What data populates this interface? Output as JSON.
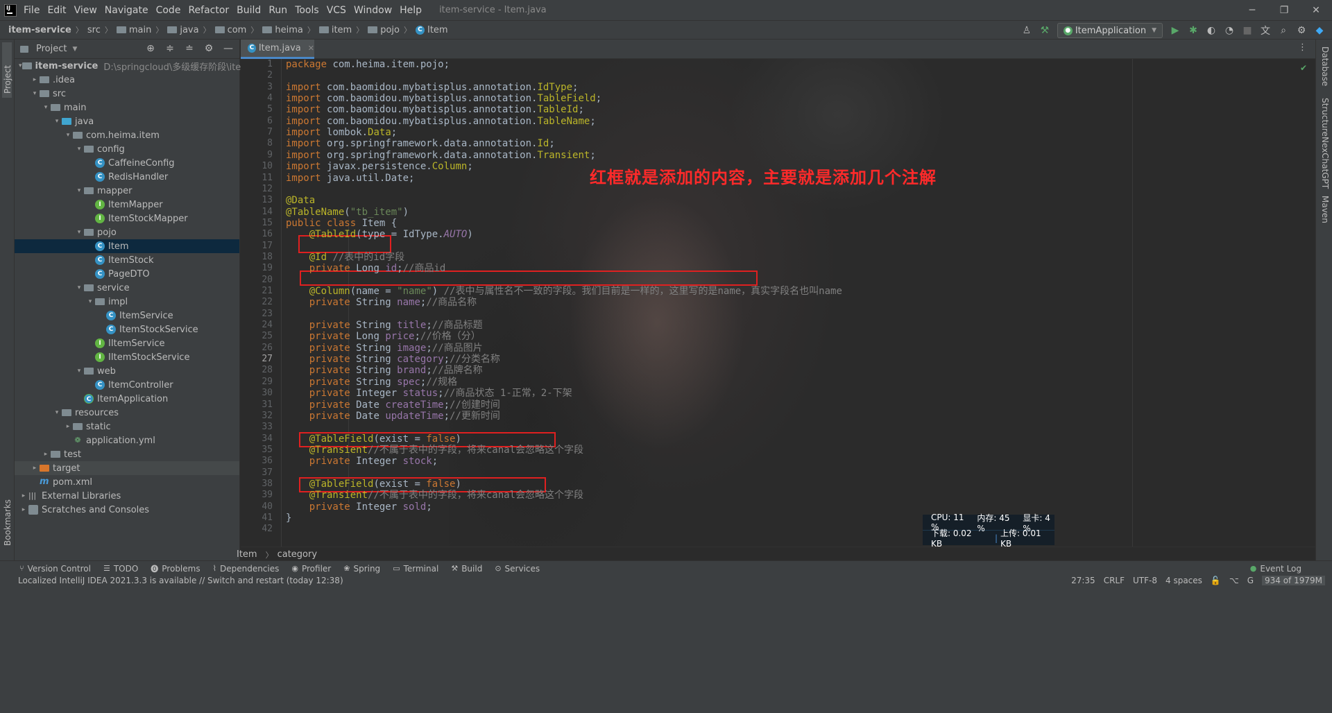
{
  "window": {
    "title": "item-service - Item.java",
    "menu": [
      "File",
      "Edit",
      "View",
      "Navigate",
      "Code",
      "Refactor",
      "Build",
      "Run",
      "Tools",
      "VCS",
      "Window",
      "Help"
    ],
    "minimize": "─",
    "restore": "❐",
    "close": "✕"
  },
  "navbar": {
    "crumbs": [
      "item-service",
      "src",
      "main",
      "java",
      "com",
      "heima",
      "item",
      "pojo",
      "Item"
    ],
    "run_config": "ItemApplication"
  },
  "left_strip": {
    "project_label": "Project",
    "bookmarks_label": "Bookmarks"
  },
  "right_strip": {
    "labels": [
      "Database",
      "Structure",
      "NexChatGPT",
      "Maven"
    ]
  },
  "project_panel": {
    "title": "Project",
    "root_name": "item-service",
    "root_path": "D:\\springcloud\\多级缓存阶段\\item-",
    "tree": [
      {
        "label": "item-service",
        "depth": 0,
        "icon": "folder",
        "chev": "down"
      },
      {
        "label": ".idea",
        "depth": 1,
        "icon": "folder",
        "chev": "right"
      },
      {
        "label": "src",
        "depth": 1,
        "icon": "folder",
        "chev": "down"
      },
      {
        "label": "main",
        "depth": 2,
        "icon": "folder",
        "chev": "down"
      },
      {
        "label": "java",
        "depth": 3,
        "icon": "folder-blue",
        "chev": "down"
      },
      {
        "label": "com.heima.item",
        "depth": 4,
        "icon": "folder",
        "chev": "down"
      },
      {
        "label": "config",
        "depth": 5,
        "icon": "folder",
        "chev": "down"
      },
      {
        "label": "CaffeineConfig",
        "depth": 6,
        "icon": "class",
        "chev": ""
      },
      {
        "label": "RedisHandler",
        "depth": 6,
        "icon": "class",
        "chev": ""
      },
      {
        "label": "mapper",
        "depth": 5,
        "icon": "folder",
        "chev": "down"
      },
      {
        "label": "ItemMapper",
        "depth": 6,
        "icon": "iface",
        "chev": ""
      },
      {
        "label": "ItemStockMapper",
        "depth": 6,
        "icon": "iface",
        "chev": ""
      },
      {
        "label": "pojo",
        "depth": 5,
        "icon": "folder",
        "chev": "down"
      },
      {
        "label": "Item",
        "depth": 6,
        "icon": "class",
        "chev": "",
        "selected": true
      },
      {
        "label": "ItemStock",
        "depth": 6,
        "icon": "class",
        "chev": ""
      },
      {
        "label": "PageDTO",
        "depth": 6,
        "icon": "class",
        "chev": ""
      },
      {
        "label": "service",
        "depth": 5,
        "icon": "folder",
        "chev": "down"
      },
      {
        "label": "impl",
        "depth": 6,
        "icon": "folder",
        "chev": "down"
      },
      {
        "label": "ItemService",
        "depth": 7,
        "icon": "class",
        "chev": ""
      },
      {
        "label": "ItemStockService",
        "depth": 7,
        "icon": "class",
        "chev": ""
      },
      {
        "label": "IItemService",
        "depth": 6,
        "icon": "iface",
        "chev": ""
      },
      {
        "label": "IItemStockService",
        "depth": 6,
        "icon": "iface",
        "chev": ""
      },
      {
        "label": "web",
        "depth": 5,
        "icon": "folder",
        "chev": "down"
      },
      {
        "label": "ItemController",
        "depth": 6,
        "icon": "class",
        "chev": ""
      },
      {
        "label": "ItemApplication",
        "depth": 5,
        "icon": "app",
        "chev": ""
      },
      {
        "label": "resources",
        "depth": 3,
        "icon": "folder",
        "chev": "down"
      },
      {
        "label": "static",
        "depth": 4,
        "icon": "folder",
        "chev": "right"
      },
      {
        "label": "application.yml",
        "depth": 4,
        "icon": "yml",
        "chev": ""
      },
      {
        "label": "test",
        "depth": 2,
        "icon": "folder",
        "chev": "right"
      },
      {
        "label": "target",
        "depth": 1,
        "icon": "folder-orange",
        "chev": "right",
        "hovered": true
      },
      {
        "label": "pom.xml",
        "depth": 1,
        "icon": "m",
        "chev": ""
      },
      {
        "label": "External Libraries",
        "depth": 0,
        "icon": "lib",
        "chev": "right"
      },
      {
        "label": "Scratches and Consoles",
        "depth": 0,
        "icon": "scratch",
        "chev": "right"
      }
    ]
  },
  "editor": {
    "tab_label": "Item.java",
    "current_line": 27,
    "annotation_text": "红框就是添加的内容，主要就是添加几个注解",
    "breadcrumb": [
      "Item",
      "category"
    ],
    "lines": [
      [
        [
          "kw",
          "package "
        ],
        [
          "",
          "com.heima.item.pojo;"
        ]
      ],
      [],
      [
        [
          "kw",
          "import "
        ],
        [
          "",
          "com.baomidou.mybatisplus.annotation."
        ],
        [
          "ann",
          "IdType"
        ],
        [
          "",
          "; "
        ]
      ],
      [
        [
          "kw",
          "import "
        ],
        [
          "",
          "com.baomidou.mybatisplus.annotation."
        ],
        [
          "ann",
          "TableField"
        ],
        [
          "",
          ";"
        ]
      ],
      [
        [
          "kw",
          "import "
        ],
        [
          "",
          "com.baomidou.mybatisplus.annotation."
        ],
        [
          "ann",
          "TableId"
        ],
        [
          "",
          ";"
        ]
      ],
      [
        [
          "kw",
          "import "
        ],
        [
          "",
          "com.baomidou.mybatisplus.annotation."
        ],
        [
          "ann",
          "TableName"
        ],
        [
          "",
          ";"
        ]
      ],
      [
        [
          "kw",
          "import "
        ],
        [
          "",
          "lombok."
        ],
        [
          "ann",
          "Data"
        ],
        [
          "",
          ";"
        ]
      ],
      [
        [
          "kw",
          "import "
        ],
        [
          "",
          "org.springframework.data.annotation."
        ],
        [
          "ann",
          "Id"
        ],
        [
          "",
          ";"
        ]
      ],
      [
        [
          "kw",
          "import "
        ],
        [
          "",
          "org.springframework.data.annotation."
        ],
        [
          "ann",
          "Transient"
        ],
        [
          "",
          ";"
        ]
      ],
      [
        [
          "kw",
          "import "
        ],
        [
          "",
          "javax.persistence."
        ],
        [
          "ann",
          "Column"
        ],
        [
          "",
          ";"
        ]
      ],
      [
        [
          "kw",
          "import "
        ],
        [
          "",
          "java.util.Date;"
        ]
      ],
      [],
      [
        [
          "ann",
          "@Data"
        ]
      ],
      [
        [
          "ann",
          "@TableName"
        ],
        [
          "",
          "("
        ],
        [
          "str",
          "\"tb_item\""
        ],
        [
          "",
          ")"
        ]
      ],
      [
        [
          "kw",
          "public class "
        ],
        [
          "",
          "Item {"
        ]
      ],
      [
        [
          "",
          "    "
        ],
        [
          "ann",
          "@TableId"
        ],
        [
          "",
          "(type = IdType."
        ],
        [
          "cst",
          "AUTO"
        ],
        [
          "",
          ")"
        ]
      ],
      [],
      [
        [
          "",
          "    "
        ],
        [
          "ann",
          "@Id "
        ],
        [
          "cmt",
          "//表中的id字段"
        ]
      ],
      [
        [
          "",
          "    "
        ],
        [
          "kw",
          "private "
        ],
        [
          "",
          "Long "
        ],
        [
          "fld",
          "id"
        ],
        [
          "",
          ";"
        ],
        [
          "cmt",
          "//商品id"
        ]
      ],
      [],
      [
        [
          "",
          "    "
        ],
        [
          "ann",
          "@Column"
        ],
        [
          "",
          "(name = "
        ],
        [
          "str",
          "\"name\""
        ],
        [
          "",
          ") "
        ],
        [
          "cmt",
          "//表中与属性名不一致的字段。我们目前是一样的，这里写的是name，真实字段名也叫name"
        ]
      ],
      [
        [
          "",
          "    "
        ],
        [
          "kw",
          "private "
        ],
        [
          "",
          "String "
        ],
        [
          "fld",
          "name"
        ],
        [
          "",
          ";"
        ],
        [
          "cmt",
          "//商品名称"
        ]
      ],
      [],
      [
        [
          "",
          "    "
        ],
        [
          "kw",
          "private "
        ],
        [
          "",
          "String "
        ],
        [
          "fld",
          "title"
        ],
        [
          "",
          ";"
        ],
        [
          "cmt",
          "//商品标题"
        ]
      ],
      [
        [
          "",
          "    "
        ],
        [
          "kw",
          "private "
        ],
        [
          "",
          "Long "
        ],
        [
          "fld",
          "price"
        ],
        [
          "",
          ";"
        ],
        [
          "cmt",
          "//价格（分）"
        ]
      ],
      [
        [
          "",
          "    "
        ],
        [
          "kw",
          "private "
        ],
        [
          "",
          "String "
        ],
        [
          "fld",
          "image"
        ],
        [
          "",
          ";"
        ],
        [
          "cmt",
          "//商品图片"
        ]
      ],
      [
        [
          "",
          "    "
        ],
        [
          "kw",
          "private "
        ],
        [
          "",
          "String "
        ],
        [
          "fld",
          "category"
        ],
        [
          "",
          ";"
        ],
        [
          "cmt",
          "//分类名称"
        ]
      ],
      [
        [
          "",
          "    "
        ],
        [
          "kw",
          "private "
        ],
        [
          "",
          "String "
        ],
        [
          "fld",
          "brand"
        ],
        [
          "",
          ";"
        ],
        [
          "cmt",
          "//品牌名称"
        ]
      ],
      [
        [
          "",
          "    "
        ],
        [
          "kw",
          "private "
        ],
        [
          "",
          "String "
        ],
        [
          "fld",
          "spec"
        ],
        [
          "",
          ";"
        ],
        [
          "cmt",
          "//规格"
        ]
      ],
      [
        [
          "",
          "    "
        ],
        [
          "kw",
          "private "
        ],
        [
          "",
          "Integer "
        ],
        [
          "fld",
          "status"
        ],
        [
          "",
          ";"
        ],
        [
          "cmt",
          "//商品状态 1-正常，2-下架"
        ]
      ],
      [
        [
          "",
          "    "
        ],
        [
          "kw",
          "private "
        ],
        [
          "",
          "Date "
        ],
        [
          "fld",
          "createTime"
        ],
        [
          "",
          ";"
        ],
        [
          "cmt",
          "//创建时间"
        ]
      ],
      [
        [
          "",
          "    "
        ],
        [
          "kw",
          "private "
        ],
        [
          "",
          "Date "
        ],
        [
          "fld",
          "updateTime"
        ],
        [
          "",
          ";"
        ],
        [
          "cmt",
          "//更新时间"
        ]
      ],
      [],
      [
        [
          "",
          "    "
        ],
        [
          "ann",
          "@TableField"
        ],
        [
          "",
          "(exist = "
        ],
        [
          "kw",
          "false"
        ],
        [
          "",
          ")"
        ]
      ],
      [
        [
          "",
          "    "
        ],
        [
          "ann",
          "@Transient"
        ],
        [
          "cmt",
          "//不属于表中的字段，将来canal会忽略这个字段"
        ]
      ],
      [
        [
          "",
          "    "
        ],
        [
          "kw",
          "private "
        ],
        [
          "",
          "Integer "
        ],
        [
          "fld",
          "stock"
        ],
        [
          "",
          ";"
        ]
      ],
      [],
      [
        [
          "",
          "    "
        ],
        [
          "ann",
          "@TableField"
        ],
        [
          "",
          "(exist = "
        ],
        [
          "kw",
          "false"
        ],
        [
          "",
          ")"
        ]
      ],
      [
        [
          "",
          "    "
        ],
        [
          "ann",
          "@Transient"
        ],
        [
          "cmt",
          "//不属于表中的字段，将来canal会忽略这个字段"
        ]
      ],
      [
        [
          "",
          "    "
        ],
        [
          "kw",
          "private "
        ],
        [
          "",
          "Integer "
        ],
        [
          "fld",
          "sold"
        ],
        [
          "",
          ";"
        ]
      ],
      [
        [
          "",
          "}"
        ]
      ],
      []
    ]
  },
  "sys_monitor": {
    "cpu": "CPU: 11 %",
    "mem": "内存: 45 %",
    "gpu": "显卡: 4 %",
    "down": "下载: 0.02 KB",
    "up": "上传: 0.01 KB"
  },
  "bottom_bar": {
    "items": [
      "Version Control",
      "TODO",
      "Problems",
      "Dependencies",
      "Profiler",
      "Spring",
      "Terminal",
      "Build",
      "Services"
    ],
    "event_log": "Event Log"
  },
  "status": {
    "message": "Localized IntelliJ IDEA 2021.3.3 is available // Switch and restart (today 12:38)",
    "position": "27:35",
    "line_sep": "CRLF",
    "encoding": "UTF-8",
    "indent": "4 spaces",
    "memory": "934 of 1979M"
  },
  "colors": {
    "accent": "#4a88c7",
    "annotation_red": "#e02020",
    "keyword": "#cc7832",
    "annotation": "#bbb529"
  }
}
